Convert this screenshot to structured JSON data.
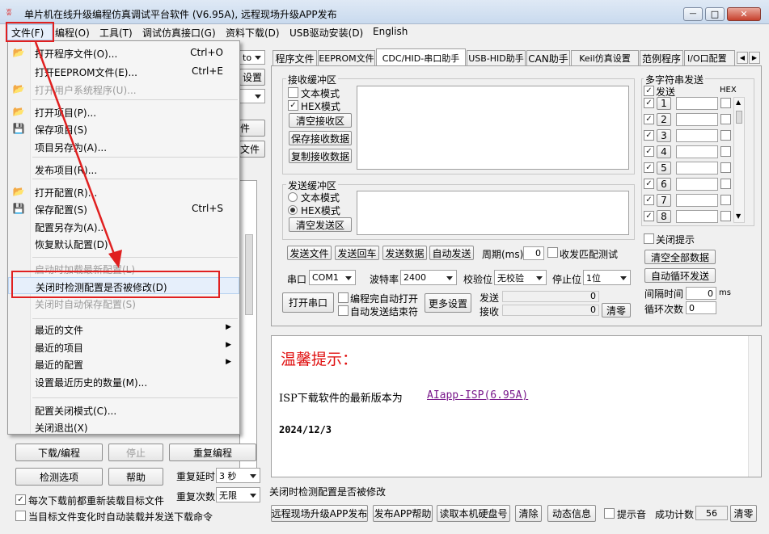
{
  "window": {
    "title": "单片机在线升级编程仿真调试平台软件 (V6.95A), 远程现场升级APP发布",
    "min": "—",
    "max": "□",
    "close": "✕"
  },
  "menubar": [
    "文件(F)",
    "编程(O)",
    "工具(T)",
    "调试仿真接口(G)",
    "资料下载(D)",
    "USB驱动安装(D)",
    "English"
  ],
  "file_menu": [
    {
      "label": "打开程序文件(O)...",
      "key": "Ctrl+O",
      "icon": "📂"
    },
    {
      "label": "打开EEPROM文件(E)...",
      "key": "Ctrl+E"
    },
    {
      "label": "打开用户系统程序(U)...",
      "key": "",
      "icon": "📂",
      "disabled": true
    },
    {
      "label": "打开项目(P)...",
      "icon": "📂"
    },
    {
      "label": "保存项目(S)",
      "icon": "💾"
    },
    {
      "label": "项目另存为(A)..."
    },
    {
      "label": "发布项目(R)..."
    },
    {
      "label": "打开配置(R)...",
      "icon": "📂"
    },
    {
      "label": "保存配置(S)",
      "key": "Ctrl+S",
      "icon": "💾"
    },
    {
      "label": "配置另存为(A)..."
    },
    {
      "label": "恢复默认配置(D)"
    },
    {
      "label": "启动时加载最新配置(L)",
      "disabled": true
    },
    {
      "label": "关闭时检测配置是否被修改(D)"
    },
    {
      "label": "关闭时自动保存配置(S)",
      "disabled": true
    },
    {
      "label": "最近的文件"
    },
    {
      "label": "最近的项目"
    },
    {
      "label": "最近的配置"
    },
    {
      "label": "设置最近历史的数量(M)..."
    },
    {
      "label": "配置关闭模式(C)..."
    },
    {
      "label": "关闭退出(X)"
    }
  ],
  "left_partial": {
    "combo1": "to",
    "btn1": "设置",
    "btn2": "件",
    "btn3": "文件"
  },
  "left_bottom": {
    "download": "下载/编程",
    "stop": "停止",
    "reprogram": "重复编程",
    "detect": "检测选项",
    "help": "帮助",
    "delay_label": "重复延时",
    "delay_value": "3 秒",
    "count_label": "重复次数",
    "count_value": "无限",
    "reload_label": "每次下载前都重新装载目标文件",
    "auto_label": "当目标文件变化时自动装载并发送下载命令"
  },
  "tabs": [
    "程序文件",
    "EEPROM文件",
    "CDC/HID-串口助手",
    "USB-HID助手",
    "CAN助手",
    "Keil仿真设置",
    "范例程序",
    "I/O口配置"
  ],
  "recv": {
    "title": "接收缓冲区",
    "text_mode": "文本模式",
    "hex_mode": "HEX模式",
    "clear": "清空接收区",
    "save": "保存接收数据",
    "copy": "复制接收数据"
  },
  "send": {
    "title": "发送缓冲区",
    "text_mode": "文本模式",
    "hex_mode": "HEX模式",
    "clear": "清空发送区"
  },
  "send_buttons": {
    "send_file": "发送文件",
    "send_return": "发送回车",
    "send_data": "发送数据",
    "auto_send": "自动发送",
    "period_label": "周期(ms)",
    "period_value": "0",
    "match_label": "收发匹配测试"
  },
  "port": {
    "port_label": "串口",
    "port_value": "COM1",
    "baud_label": "波特率",
    "baud_value": "2400",
    "parity_label": "校验位",
    "parity_value": "无校验",
    "stop_label": "停止位",
    "stop_value": "1位",
    "open": "打开串口",
    "auto_open": "编程完自动打开",
    "auto_end": "自动发送结束符",
    "more": "更多设置",
    "send_label": "发送",
    "send_count": "0",
    "recv_label": "接收",
    "recv_count": "0",
    "clear_count": "清零"
  },
  "multi": {
    "title": "多字符串发送",
    "send_col": "发送",
    "hex_col": "HEX",
    "rows": [
      "1",
      "2",
      "3",
      "4",
      "5",
      "6",
      "7",
      "8"
    ],
    "close_hint": "关闭提示",
    "clear_all": "清空全部数据",
    "auto_loop": "自动循环发送",
    "interval_label": "间隔时间",
    "interval_value": "0",
    "interval_unit": "ms",
    "loop_label": "循环次数",
    "loop_value": "0"
  },
  "notice": {
    "title": "温馨提示：",
    "line": "ISP下载软件的最新版本为",
    "link": "AIapp-ISP(6.95A)",
    "date": "2024/12/3"
  },
  "statusbar": "关闭时检测配置是否被修改",
  "bottom": {
    "b1": "远程现场升级APP发布",
    "b2": "发布APP帮助",
    "b3": "读取本机硬盘号",
    "b4": "清除",
    "b5": "动态信息",
    "beep": "提示音",
    "success_label": "成功计数",
    "success_value": "56",
    "clear": "清零"
  }
}
